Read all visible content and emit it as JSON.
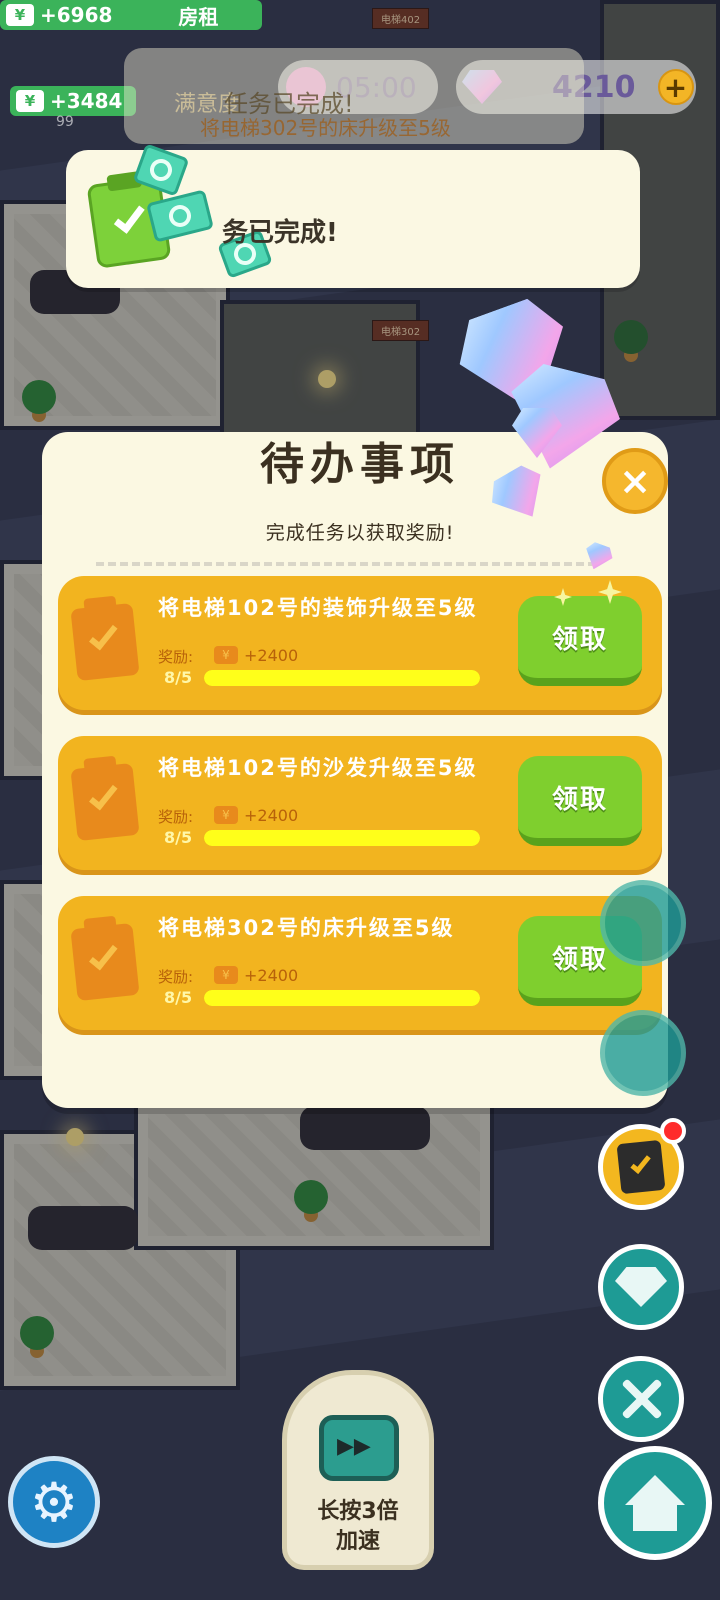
{
  "hud": {
    "money_top": "+6968",
    "money_second": "+3484",
    "rent_label": "房租",
    "timer": "05:00",
    "gems": "4210",
    "plus": "+",
    "satisfaction_label": "满意度",
    "small_count": "99"
  },
  "room_labels": [
    "电梯402",
    "电梯302"
  ],
  "toast": {
    "ghost_title": "任务已完成!",
    "ghost_subtitle": "将电梯302号的床升级至5级",
    "text": "务已完成!"
  },
  "panel": {
    "title": "待办事项",
    "subtitle": "完成任务以获取奖励!",
    "close_glyph": "×"
  },
  "tasks": [
    {
      "name": "将电梯102号的装饰升级至5级",
      "reward_label": "奖励:",
      "reward_icon": "¥",
      "reward": "+2400",
      "progress_text": "8/5",
      "progress": 1.0,
      "button": "领取"
    },
    {
      "name": "将电梯102号的沙发升级至5级",
      "reward_label": "奖励:",
      "reward_icon": "¥",
      "reward": "+2400",
      "progress_text": "8/5",
      "progress": 1.0,
      "button": "领取"
    },
    {
      "name": "将电梯302号的床升级至5级",
      "reward_label": "奖励:",
      "reward_icon": "¥",
      "reward": "+2400",
      "progress_text": "8/5",
      "progress": 1.0,
      "button": "领取"
    }
  ],
  "speed_button": {
    "label": "长按3倍\n加速"
  },
  "icons": {
    "currency": "yen-icon",
    "gem": "diamond-icon",
    "settings": "gear-icon",
    "tasks": "clipboard-check-icon",
    "shop": "gem-shop-icon",
    "upgrade": "tools-icon",
    "home": "house-icon",
    "speed": "tv-fast-forward-icon"
  },
  "colors": {
    "panel_bg": "#fbf8e2",
    "task_card": "#f2b41f",
    "claim_button": "#7fcf2e",
    "progress_fill": "#ffff1a",
    "money_green": "#3bb35a",
    "accent_teal": "#1e9b95"
  }
}
